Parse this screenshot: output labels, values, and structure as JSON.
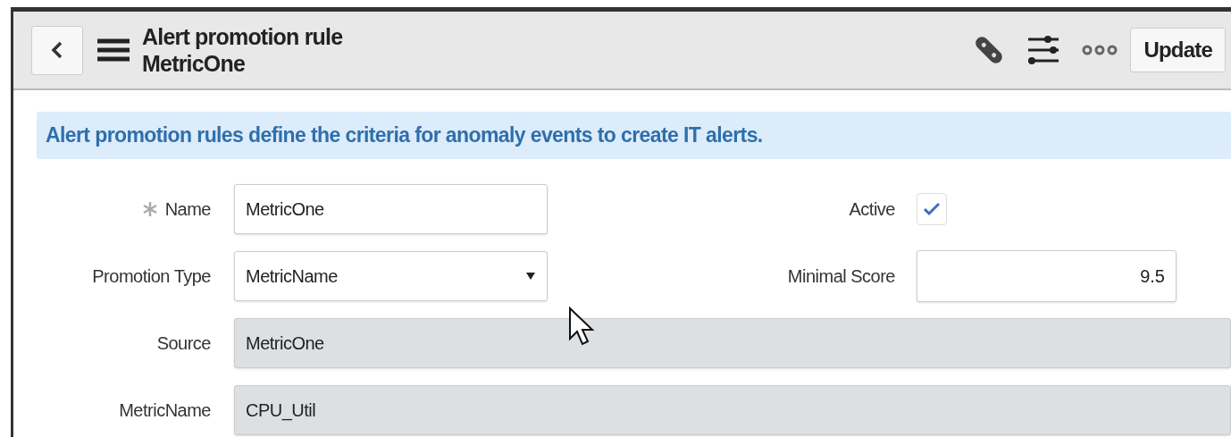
{
  "header": {
    "title": "Alert promotion rule",
    "subtitle": "MetricOne",
    "update_button": "Update"
  },
  "info_message": "Alert promotion rules define the criteria for anomaly events to create IT alerts.",
  "form": {
    "left": [
      {
        "kind": "text",
        "label": "Name",
        "required": true,
        "value": "MetricOne",
        "disabled": false
      },
      {
        "kind": "select",
        "label": "Promotion Type",
        "required": false,
        "value": "MetricName",
        "disabled": false
      }
    ],
    "right": [
      {
        "kind": "checkbox",
        "label": "Active",
        "checked": true
      },
      {
        "kind": "number",
        "label": "Minimal Score",
        "value": "9.5"
      }
    ],
    "full": [
      {
        "kind": "text",
        "label": "Source",
        "required": false,
        "value": "MetricOne",
        "disabled": true
      },
      {
        "kind": "text",
        "label": "MetricName",
        "required": false,
        "value": "CPU_Util",
        "disabled": true
      }
    ]
  }
}
